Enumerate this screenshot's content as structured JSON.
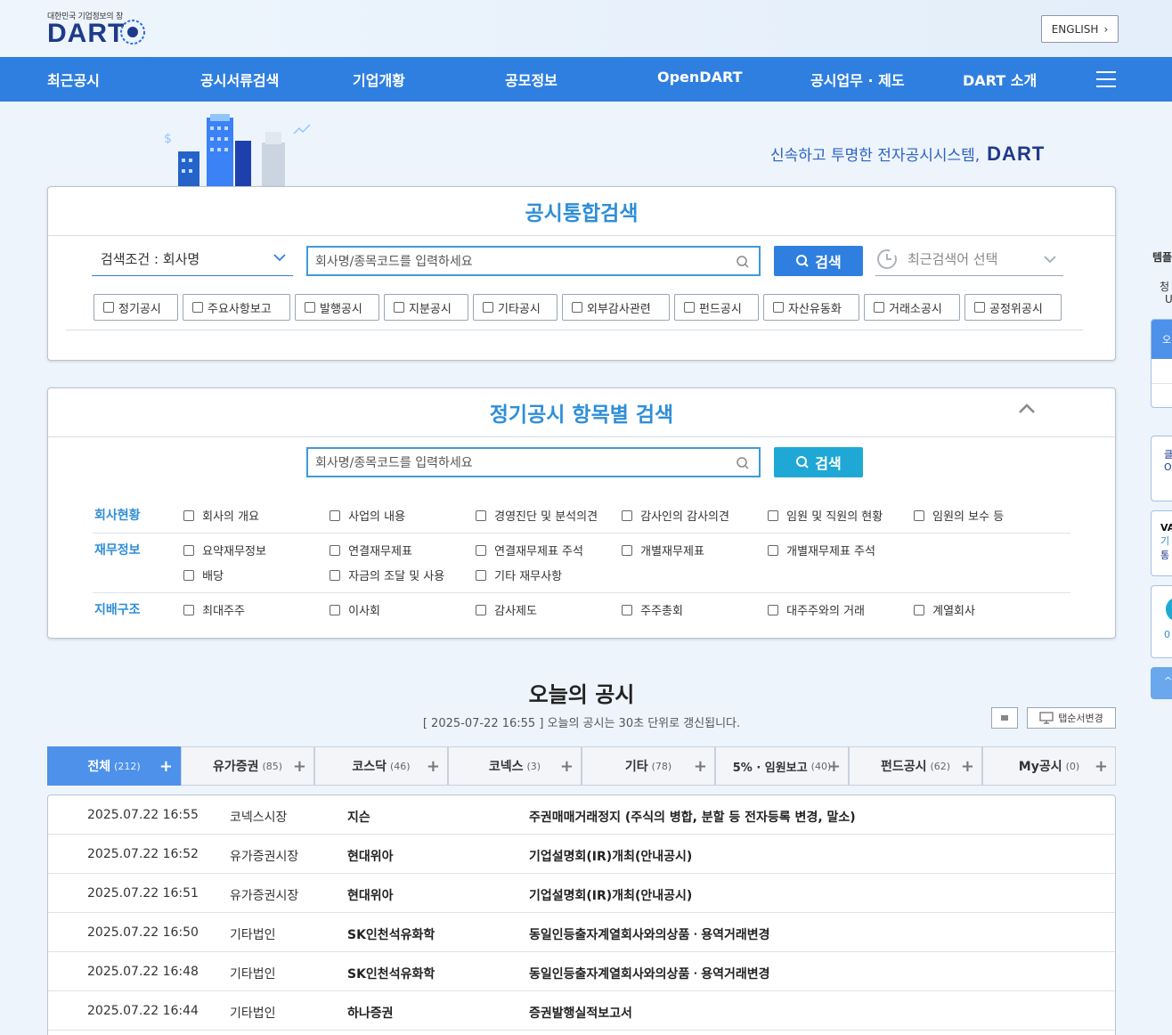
{
  "header": {
    "logo_tagline": "대한민국 기업정보의 창",
    "logo_text": "DART",
    "english_label": "ENGLISH"
  },
  "nav": {
    "items": [
      "최근공시",
      "공시서류검색",
      "기업개황",
      "공모정보",
      "OpenDART",
      "공시업무 · 제도",
      "DART 소개"
    ]
  },
  "hero": {
    "slogan": "신속하고 투명한 전자공시시스템,",
    "brand": "DART"
  },
  "integrated_search": {
    "title": "공시통합검색",
    "condition_label": "검색조건 : 회사명",
    "placeholder": "회사명/종목코드를 입력하세요",
    "search_label": "검색",
    "recent_label": "최근검색어 선택",
    "filters": [
      "정기공시",
      "주요사항보고",
      "발행공시",
      "지분공시",
      "기타공시",
      "외부감사관련",
      "펀드공시",
      "자산유동화",
      "거래소공시",
      "공정위공시"
    ]
  },
  "periodic_search": {
    "title": "정기공시 항목별 검색",
    "placeholder": "회사명/종목코드를 입력하세요",
    "search_label": "검색",
    "categories": [
      {
        "label": "회사현황",
        "options": [
          "회사의 개요",
          "사업의 내용",
          "경영진단 및 분석의견",
          "감사인의 감사의견",
          "임원 및 직원의 현황",
          "임원의 보수 등"
        ]
      },
      {
        "label": "재무정보",
        "options": [
          "요약재무정보",
          "연결재무제표",
          "연결재무제표 주석",
          "개별재무제표",
          "개별재무제표 주석",
          "배당",
          "자금의 조달 및 사용",
          "기타 재무사항"
        ]
      },
      {
        "label": "지배구조",
        "options": [
          "최대주주",
          "이사회",
          "감사제도",
          "주주총회",
          "대주주와의 거래",
          "계열회사"
        ]
      }
    ]
  },
  "today": {
    "title": "오늘의 공시",
    "subtitle": "[ 2025-07-22 16:55 ] 오늘의 공시는 30초 단위로 갱신됩니다.",
    "tab_order_label": "탭순서변경",
    "tabs": [
      {
        "label": "전체",
        "count": "(212)"
      },
      {
        "label": "유가증권",
        "count": "(85)"
      },
      {
        "label": "코스닥",
        "count": "(46)"
      },
      {
        "label": "코넥스",
        "count": "(3)"
      },
      {
        "label": "기타",
        "count": "(78)"
      },
      {
        "label": "5% · 임원보고",
        "count": "(40)"
      },
      {
        "label": "펀드공시",
        "count": "(62)"
      },
      {
        "label": "My공시",
        "count": "(0)"
      }
    ],
    "rows": [
      {
        "time": "2025.07.22  16:55",
        "market": "코넥스시장",
        "company": "지슨",
        "report": "주권매매거래정지 (주식의 병합, 분할 등 전자등록 변경, 말소)"
      },
      {
        "time": "2025.07.22  16:52",
        "market": "유가증권시장",
        "company": "현대위아",
        "report": "기업설명회(IR)개최(안내공시)"
      },
      {
        "time": "2025.07.22  16:51",
        "market": "유가증권시장",
        "company": "현대위아",
        "report": "기업설명회(IR)개최(안내공시)"
      },
      {
        "time": "2025.07.22  16:50",
        "market": "기타법인",
        "company": "SK인천석유화학",
        "report": "동일인등출자계열회사와의상품ㆍ용역거래변경"
      },
      {
        "time": "2025.07.22  16:48",
        "market": "기타법인",
        "company": "SK인천석유화학",
        "report": "동일인등출자계열회사와의상품ㆍ용역거래변경"
      },
      {
        "time": "2025.07.22  16:44",
        "market": "기타법인",
        "company": "하나증권",
        "report": "증권발행실적보고서"
      }
    ]
  },
  "sidebar": {
    "top_label": "템플",
    "line2": "청",
    "line3": "U",
    "item_a": "오",
    "item_b1": "클",
    "item_b2": "O",
    "item_c1": "VA",
    "item_c2": "기",
    "item_c3": "통",
    "item_d": "0",
    "item_e": "^"
  },
  "colors": {
    "primary": "#2f7fe0",
    "accent": "#2f8ed8",
    "search_btn_cyan": "#1fa8d6",
    "navy": "#1e3a8a"
  }
}
